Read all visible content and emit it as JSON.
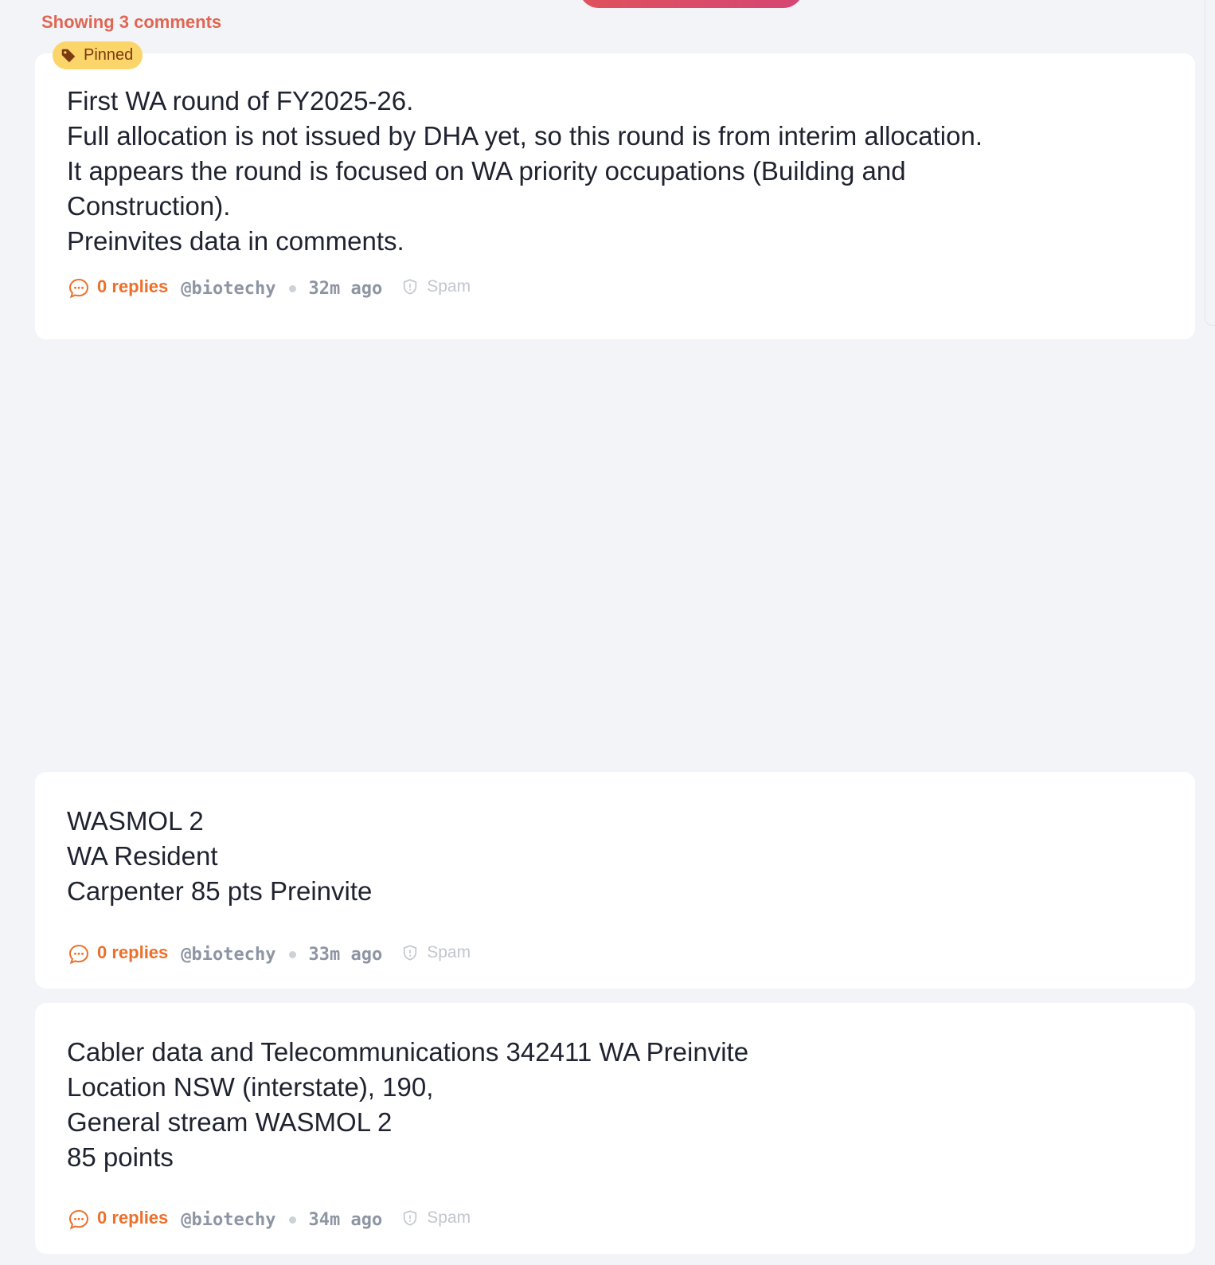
{
  "header": {
    "count_label": "Showing 3 comments"
  },
  "colors": {
    "accent_orange": "#ec6f2a",
    "count_text": "#e06654",
    "pinned_badge_bg": "#fbd46a",
    "pinned_badge_text": "#7a3b12",
    "top_pill_gradient_start": "#e0525d",
    "top_pill_gradient_end": "#d54674",
    "background": "#f3f4f7",
    "card": "#ffffff"
  },
  "comments": [
    {
      "pinned": true,
      "pinned_label": "Pinned",
      "pinned_icon": "tag-icon",
      "lines": [
        "First WA round of FY2025-26.",
        "Full allocation is not issued by DHA yet, so this round is from interim allocation.",
        "It appears the round is focused on WA priority occupations (Building and",
        "Construction).",
        "Preinvites data in comments."
      ],
      "replies_label": "0 replies",
      "reply_icon": "chat-bubble-icon",
      "author": "@biotechy",
      "time": "32m ago",
      "spam_label": "Spam",
      "spam_icon": "shield-icon"
    },
    {
      "pinned": false,
      "lines": [
        "WASMOL 2",
        "WA Resident",
        "Carpenter 85 pts Preinvite"
      ],
      "replies_label": "0 replies",
      "reply_icon": "chat-bubble-icon",
      "author": "@biotechy",
      "time": "33m ago",
      "spam_label": "Spam",
      "spam_icon": "shield-icon"
    },
    {
      "pinned": false,
      "lines": [
        "Cabler data and Telecommunications 342411 WA Preinvite",
        "Location NSW (interstate), 190,",
        "General stream WASMOL 2",
        "85 points"
      ],
      "replies_label": "0 replies",
      "reply_icon": "chat-bubble-icon",
      "author": "@biotechy",
      "time": "34m ago",
      "spam_label": "Spam",
      "spam_icon": "shield-icon"
    }
  ]
}
